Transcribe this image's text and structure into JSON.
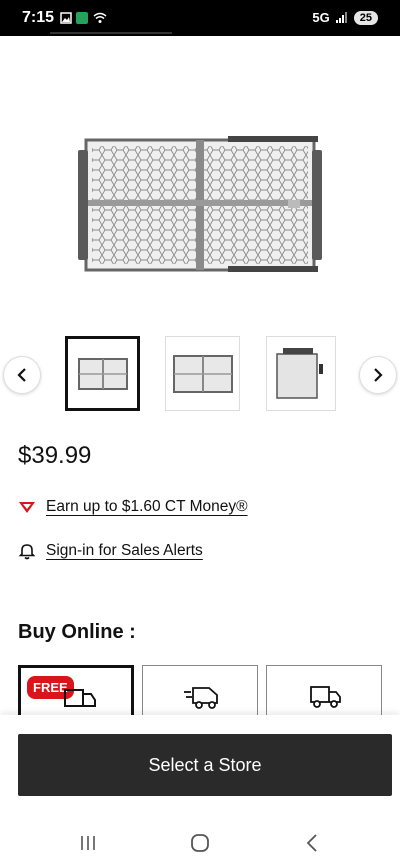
{
  "status_bar": {
    "time": "7:15",
    "network": "5G",
    "battery": "25"
  },
  "product": {
    "price": "$39.99",
    "ct_money_text": "Earn up to $1.60 CT Money®",
    "sales_alert_text": "Sign-in for Sales Alerts"
  },
  "buy_online": {
    "title": "Buy Online :",
    "options": [
      {
        "badge": "FREE",
        "icon": "delivery-truck-icon"
      },
      {
        "icon": "fast-delivery-van-icon"
      },
      {
        "icon": "truck-icon"
      }
    ]
  },
  "cta": {
    "select_store_label": "Select a Store"
  },
  "colors": {
    "brand_red": "#d9141c",
    "cta_dark": "#2a2a2a"
  }
}
